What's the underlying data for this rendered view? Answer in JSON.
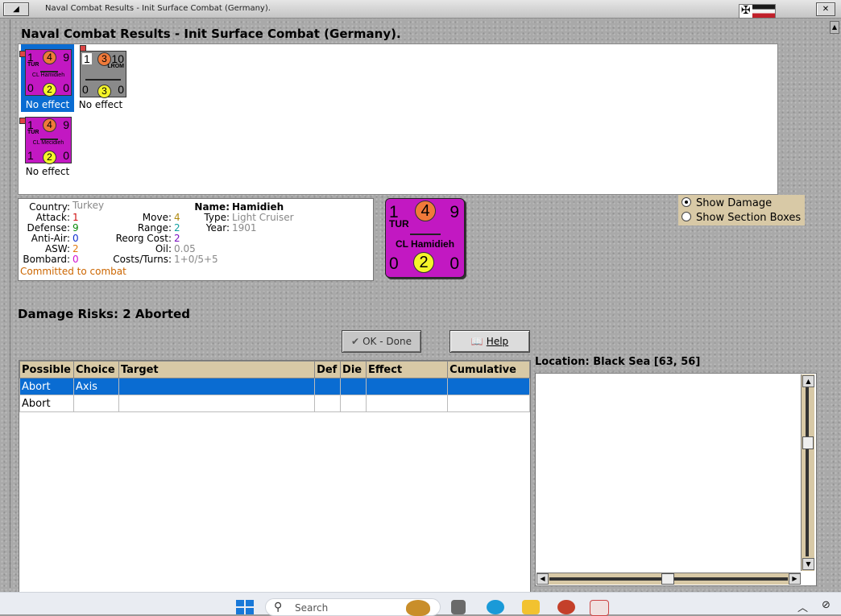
{
  "window": {
    "title": "Naval Combat Results - Init Surface Combat (Germany).",
    "heading": "Naval Combat Results - Init Surface Combat (Germany).",
    "close_glyph": "✕",
    "menu_glyph": "◢"
  },
  "combat_units": [
    {
      "top_left": "1",
      "top_mid": "4",
      "top_right": "9",
      "nation": "TUR",
      "name": "CL Hamidieh",
      "bottom_left": "0",
      "bottom_mid": "2",
      "bottom_right": "0",
      "result": "No effect",
      "color": "#c218c2",
      "selected": true
    },
    {
      "top_left": "1",
      "top_mid": "3",
      "top_right": "10",
      "nation": "LROM",
      "name": "",
      "bottom_left": "0",
      "bottom_mid": "3",
      "bottom_right": "0",
      "result": "No effect",
      "color": "#8a8a8a",
      "selected": false
    },
    {
      "top_left": "1",
      "top_mid": "4",
      "top_right": "9",
      "nation": "TUR",
      "name": "CL Mecidieh",
      "bottom_left": "1",
      "bottom_mid": "2",
      "bottom_right": "0",
      "result": "No effect",
      "color": "#c218c2",
      "selected": false
    }
  ],
  "unit_info": {
    "country_label": "Country:",
    "country": "Turkey",
    "attack_label": "Attack:",
    "attack": "1",
    "defense_label": "Defense:",
    "defense": "9",
    "antiair_label": "Anti-Air:",
    "antiair": "0",
    "asw_label": "ASW:",
    "asw": "2",
    "bombard_label": "Bombard:",
    "bombard": "0",
    "move_label": "Move:",
    "move": "4",
    "range_label": "Range:",
    "range": "2",
    "reorg_label": "Reorg Cost:",
    "reorg": "2",
    "oil_label": "Oil:",
    "oil": "0.05",
    "costs_label": "Costs/Turns:",
    "costs": "1+0/5+5",
    "name_label": "Name:",
    "name": "Hamidieh",
    "type_label": "Type:",
    "type": "Light Cruiser",
    "year_label": "Year:",
    "year": "1901",
    "status": "Committed to combat"
  },
  "big_counter": {
    "top_left": "1",
    "top_mid": "4",
    "top_right": "9",
    "nation": "TUR",
    "name": "CL Hamidieh",
    "bottom_left": "0",
    "bottom_mid": "2",
    "bottom_right": "0"
  },
  "options": {
    "show_damage": "Show Damage",
    "show_sections": "Show Section Boxes",
    "selected": "show_damage"
  },
  "damage_risks": "Damage Risks:  2 Aborted",
  "buttons": {
    "ok": "OK - Done",
    "help": "Help"
  },
  "table": {
    "columns": [
      "Possible",
      "Choice",
      "Target",
      "Def",
      "Die",
      "Effect",
      "Cumulative"
    ],
    "rows": [
      {
        "possible": "Abort",
        "choice": "Axis",
        "target": "",
        "def": "",
        "die": "",
        "effect": "",
        "cumulative": "",
        "selected": true
      },
      {
        "possible": "Abort",
        "choice": "",
        "target": "",
        "def": "",
        "die": "",
        "effect": "",
        "cumulative": "",
        "selected": false
      }
    ]
  },
  "location": "Location:  Black Sea [63, 56]",
  "taskbar": {
    "search_placeholder": "Search"
  },
  "colors": {
    "panel_tan": "#d8c9a6",
    "selection_blue": "#0a6cd2",
    "unit_magenta": "#c218c2",
    "status_orange": "#cc6600"
  }
}
